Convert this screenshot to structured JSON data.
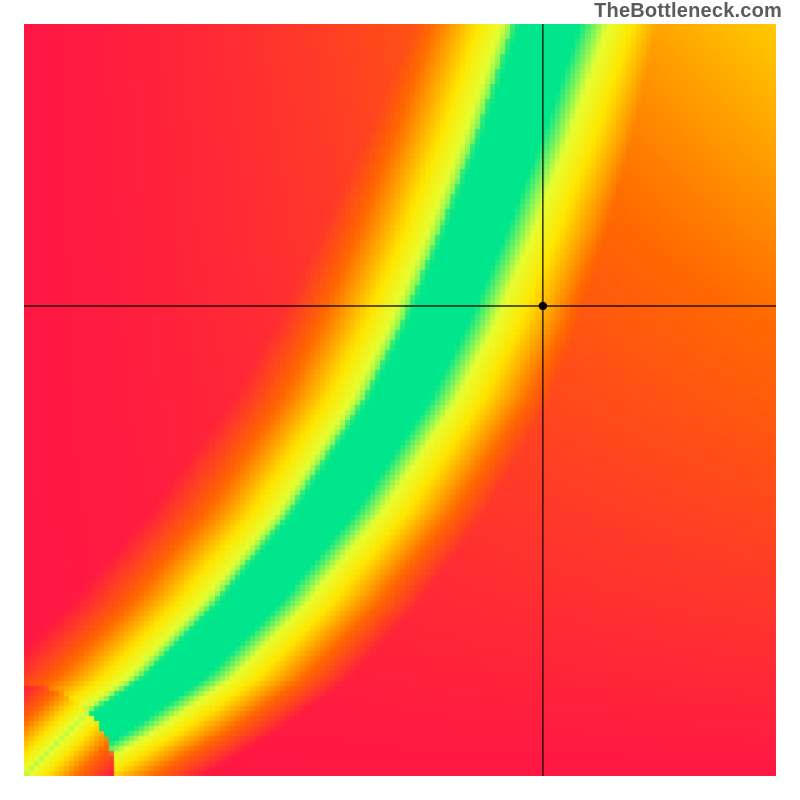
{
  "watermark": "TheBottleneck.com",
  "chart_data": {
    "type": "heatmap",
    "title": "",
    "xlabel": "",
    "ylabel": "",
    "xlim": [
      0,
      1
    ],
    "ylim": [
      0,
      1
    ],
    "colormap": {
      "description": "diverging red-yellow-green; green = best match, red = worst",
      "stops": [
        {
          "t": 0.0,
          "color": "#ff1744"
        },
        {
          "t": 0.35,
          "color": "#ff6a00"
        },
        {
          "t": 0.65,
          "color": "#ffe600"
        },
        {
          "t": 0.82,
          "color": "#e6ff33"
        },
        {
          "t": 1.0,
          "color": "#00e68c"
        }
      ]
    },
    "optimal_curve": {
      "description": "approximate centerline of the green band, in normalized (x,y) coords origin bottom-left",
      "points": [
        [
          0.0,
          0.0
        ],
        [
          0.1,
          0.06
        ],
        [
          0.2,
          0.13
        ],
        [
          0.3,
          0.23
        ],
        [
          0.4,
          0.35
        ],
        [
          0.5,
          0.5
        ],
        [
          0.55,
          0.6
        ],
        [
          0.6,
          0.72
        ],
        [
          0.65,
          0.85
        ],
        [
          0.7,
          1.0
        ]
      ]
    },
    "band_halfwidth_x": 0.04,
    "corner_bias": {
      "description": "approximate goodness at corners (0=red,1=green)",
      "bottom_left": 0.0,
      "bottom_right": 0.0,
      "top_left": 0.0,
      "top_right": 0.65
    },
    "crosshair": {
      "x": 0.69,
      "y": 0.625
    }
  }
}
